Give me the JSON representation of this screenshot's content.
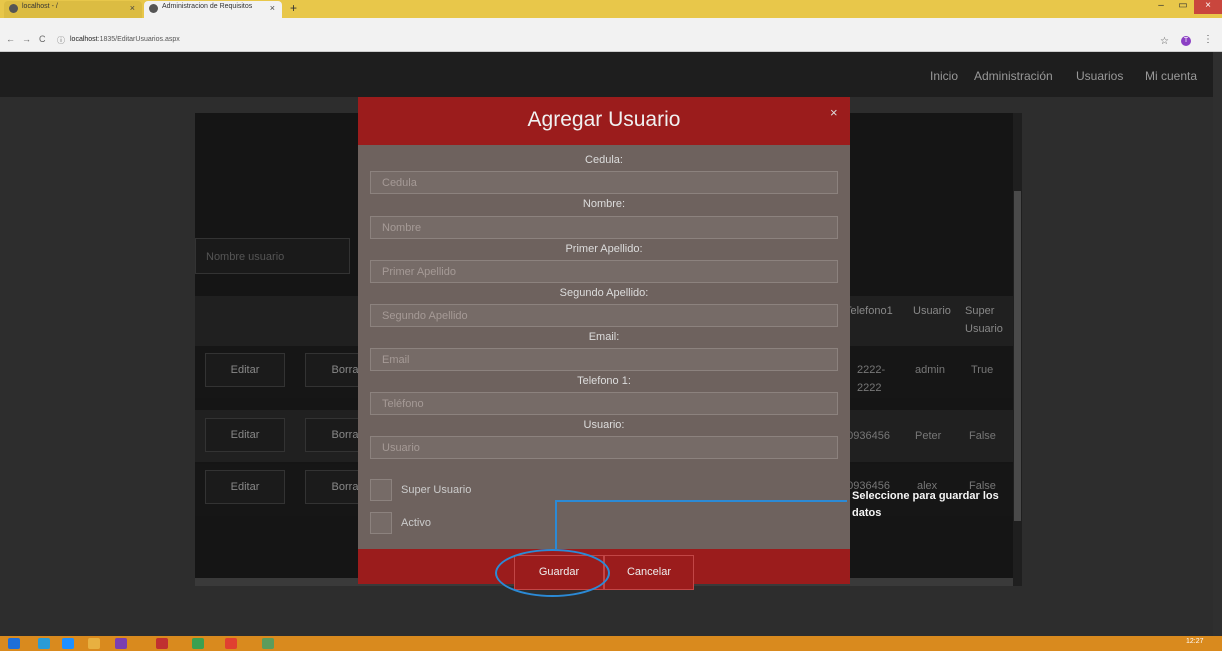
{
  "browser": {
    "tabs": [
      {
        "label": "localhost - /",
        "active": false
      },
      {
        "label": "Administracion de Requisitos",
        "active": true
      }
    ],
    "new_tab": "+",
    "url_host": "localhost",
    "url_path": ":1835/EditarUsuarios.aspx",
    "nav": {
      "back": "←",
      "forward": "→",
      "reload": "C",
      "info": "ⓘ"
    },
    "star": "☆",
    "profile_initial": "T",
    "menu": "⋮",
    "window": {
      "minimize": "–",
      "maximize": "▭",
      "close": "×"
    }
  },
  "site_nav": {
    "items": [
      "Inicio",
      "Administración",
      "Usuarios",
      "Mi cuenta"
    ]
  },
  "background_page": {
    "search_placeholder": "Nombre usuario",
    "headers": {
      "telefono1": "Telefono1",
      "usuario": "Usuario",
      "super_usuario_1": "Super",
      "super_usuario_2": "Usuario"
    },
    "rows": [
      {
        "edit": "Editar",
        "delete": "Borra",
        "telefono_a": "2222-",
        "telefono_b": "2222",
        "usuario": "admin",
        "super": "True"
      },
      {
        "edit": "Editar",
        "delete": "Borra",
        "telefono_a": "60936456",
        "telefono_b": "",
        "usuario": "Peter",
        "super": "False"
      },
      {
        "edit": "Editar",
        "delete": "Borra",
        "telefono_a": "60936456",
        "telefono_b": "",
        "usuario": "alex",
        "super": "False"
      }
    ]
  },
  "modal": {
    "title": "Agregar Usuario",
    "close": "×",
    "fields": [
      {
        "label": "Cedula:",
        "placeholder": "Cedula"
      },
      {
        "label": "Nombre:",
        "placeholder": "Nombre"
      },
      {
        "label": "Primer Apellido:",
        "placeholder": "Primer Apellido"
      },
      {
        "label": "Segundo Apellido:",
        "placeholder": "Segundo Apellido"
      },
      {
        "label": "Email:",
        "placeholder": "Email"
      },
      {
        "label": "Telefono 1:",
        "placeholder": "Teléfono"
      },
      {
        "label": "Usuario:",
        "placeholder": "Usuario"
      }
    ],
    "checkboxes": [
      {
        "label": "Super Usuario",
        "checked": false
      },
      {
        "label": "Activo",
        "checked": false
      }
    ],
    "save_label": "Guardar",
    "cancel_label": "Cancelar"
  },
  "annotation": {
    "text": "Seleccione para guardar los datos",
    "color": "#2b8ad6"
  },
  "taskbar": {
    "clock": "12:27",
    "icon_colors": [
      "#1e6fd9",
      "#2a9bd6",
      "#1e90ff",
      "#e8b040",
      "#7a3fb0",
      "#c03030",
      "#3ca050",
      "#e04030",
      "#5c9c5c"
    ]
  },
  "colors": {
    "modal_header": "#9b1c1c",
    "modal_body": "#6e625e",
    "tab_bar": "#e8c74a",
    "taskbar": "#d98a1e"
  }
}
